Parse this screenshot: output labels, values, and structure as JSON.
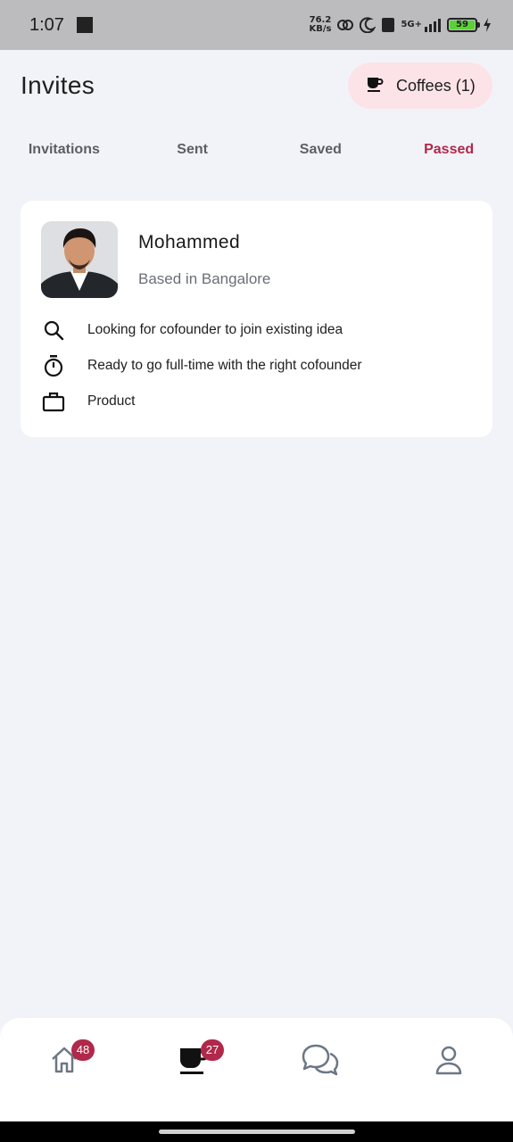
{
  "status_bar": {
    "time": "1:07",
    "net_speed_value": "76.2",
    "net_speed_unit": "KB/s",
    "network": "5G+",
    "battery": "59"
  },
  "header": {
    "title": "Invites",
    "coffees_label": "Coffees (1)"
  },
  "tabs": [
    {
      "label": "Invitations",
      "active": false
    },
    {
      "label": "Sent",
      "active": false
    },
    {
      "label": "Saved",
      "active": false
    },
    {
      "label": "Passed",
      "active": true
    }
  ],
  "profile_card": {
    "name": "Mohammed",
    "location": "Based in Bangalore",
    "details": [
      {
        "icon": "search-icon",
        "text": "Looking for cofounder to join existing idea"
      },
      {
        "icon": "stopwatch-icon",
        "text": "Ready to go full-time with the right cofounder"
      },
      {
        "icon": "briefcase-icon",
        "text": "Product"
      }
    ]
  },
  "bottom_nav": {
    "items": [
      {
        "icon": "home-icon",
        "badge": "48"
      },
      {
        "icon": "coffee-cup-icon",
        "badge": "27",
        "active": true
      },
      {
        "icon": "chat-bubbles-icon"
      },
      {
        "icon": "profile-icon"
      }
    ]
  },
  "colors": {
    "accent": "#b0284a",
    "coffee_button_bg": "#fbe3e8",
    "background": "#f2f3f8"
  }
}
